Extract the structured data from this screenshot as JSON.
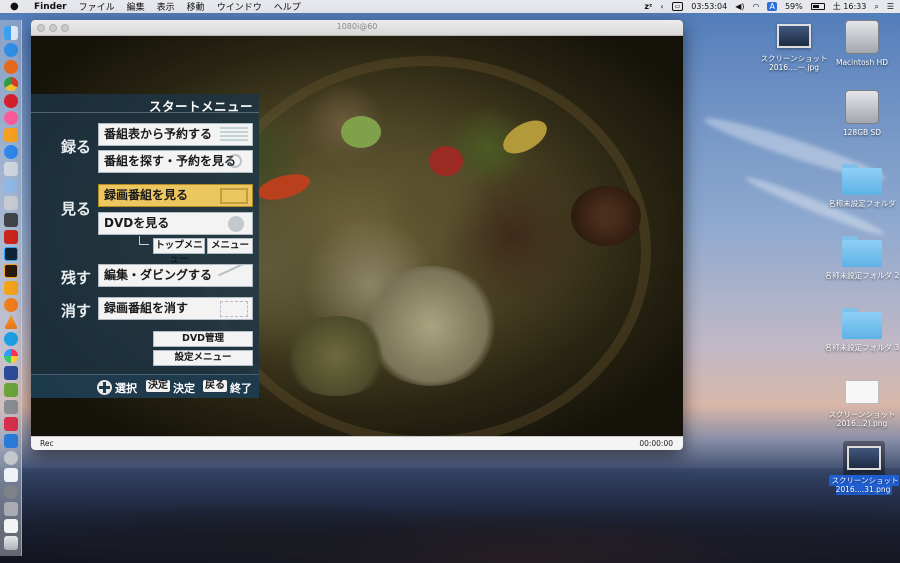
{
  "menubar": {
    "apple": "",
    "app": "Finder",
    "items": [
      "ファイル",
      "編集",
      "表示",
      "移動",
      "ウインドウ",
      "ヘルプ"
    ],
    "clock_time": "03:53:04",
    "battery": "59%",
    "ime": "A",
    "datetime": "土 16:33"
  },
  "window": {
    "title": "1080i@60",
    "status_left": "Rec",
    "status_right": "00:00:00"
  },
  "overlay": {
    "title": "スタートメニュー",
    "categories": {
      "record": "録る",
      "watch": "見る",
      "keep": "残す",
      "erase": "消す"
    },
    "buttons": {
      "reserve_from_guide": "番組表から予約する",
      "find_and_reserve": "番組を探す・予約を見る",
      "watch_recorded": "録画番組を見る",
      "watch_dvd": "DVDを見る",
      "top_menu": "トップメニュー",
      "menu": "メニュー",
      "edit_dub": "編集・ダビングする",
      "delete_recorded": "録画番組を消す",
      "dvd_manage": "DVD管理",
      "settings_menu": "設定メニュー"
    },
    "footer": {
      "select": "選択",
      "enter_key": "決定",
      "enter": "決定",
      "back_key": "戻る",
      "exit": "終了"
    }
  },
  "desktop": {
    "icons": [
      {
        "label": "スクリーンショット 2016....ー.jpg"
      },
      {
        "label": "Macintosh HD"
      },
      {
        "label": "128GB SD"
      },
      {
        "label": "名称未設定フォルダ"
      },
      {
        "label": "名称未設定フォルダ 2"
      },
      {
        "label": "名称未設定フォルダ 3"
      },
      {
        "label": "スクリーンショット 2016...2).png"
      },
      {
        "label": "スクリーンショット 2016....31.png"
      }
    ]
  }
}
